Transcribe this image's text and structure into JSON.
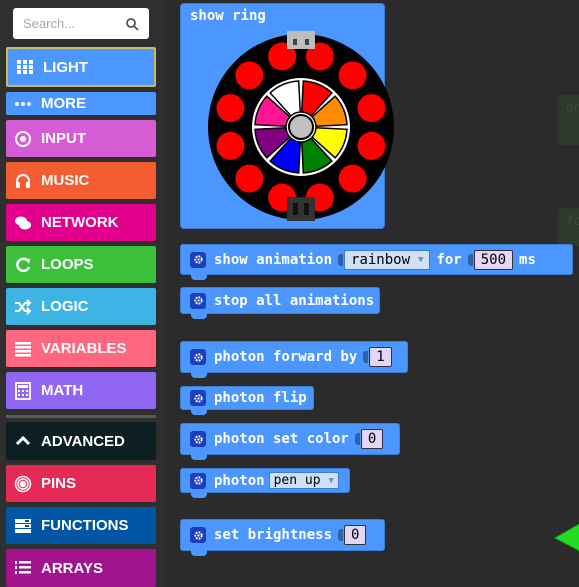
{
  "sidebar": {
    "search_placeholder": "Search...",
    "categories": [
      {
        "label": "LIGHT",
        "icon": "grid-icon",
        "color": "#4c97ff",
        "selected": true
      },
      {
        "label": "MORE",
        "icon": "more-dots-icon",
        "color": "#4c97ff"
      },
      {
        "label": "INPUT",
        "icon": "input-target-icon",
        "color": "#d65cd6"
      },
      {
        "label": "MUSIC",
        "icon": "headphones-icon",
        "color": "#f45d32"
      },
      {
        "label": "NETWORK",
        "icon": "chat-bubbles-icon",
        "color": "#e3008c"
      },
      {
        "label": "LOOPS",
        "icon": "refresh-icon",
        "color": "#3cc03c"
      },
      {
        "label": "LOGIC",
        "icon": "shuffle-icon",
        "color": "#3db4e4"
      },
      {
        "label": "VARIABLES",
        "icon": "list-lines-icon",
        "color": "#ff6680"
      },
      {
        "label": "MATH",
        "icon": "calculator-icon",
        "color": "#9166f2"
      },
      {
        "label": "ADVANCED",
        "icon": "chevron-up-icon",
        "color": "#0d1f23"
      },
      {
        "label": "PINS",
        "icon": "pins-target-icon",
        "color": "#e52a55"
      },
      {
        "label": "FUNCTIONS",
        "icon": "functions-icon",
        "color": "#0055a5"
      },
      {
        "label": "ARRAYS",
        "icon": "numbered-list-icon",
        "color": "#a2138e"
      }
    ]
  },
  "workspace": {
    "ghost_blocks": [
      "on",
      "fo"
    ],
    "blocks": {
      "show_ring": {
        "label": "show ring"
      },
      "show_animation": {
        "label": "show animation",
        "dropdown": "rainbow",
        "for_label": "for",
        "duration": "500",
        "unit": "ms"
      },
      "stop_animations": {
        "label": "stop all animations"
      },
      "photon_forward": {
        "label": "photon forward by",
        "value": "1"
      },
      "photon_flip": {
        "label": "photon flip"
      },
      "photon_set_color": {
        "label": "photon set color",
        "value": "0"
      },
      "photon_pen": {
        "label": "photon",
        "dropdown": "pen up"
      },
      "set_brightness": {
        "label": "set brightness",
        "value": "0"
      }
    },
    "ring": {
      "led_color": "#ff0000",
      "led_count": 12,
      "wheel_colors": [
        "#ffffff",
        "#ff0000",
        "#ff8c00",
        "#ffff00",
        "#008000",
        "#0000ff",
        "#800080",
        "#ff1493"
      ],
      "center_color": "#c0c0c0"
    },
    "annotation": {
      "arrow_color": "#22dd22"
    }
  }
}
